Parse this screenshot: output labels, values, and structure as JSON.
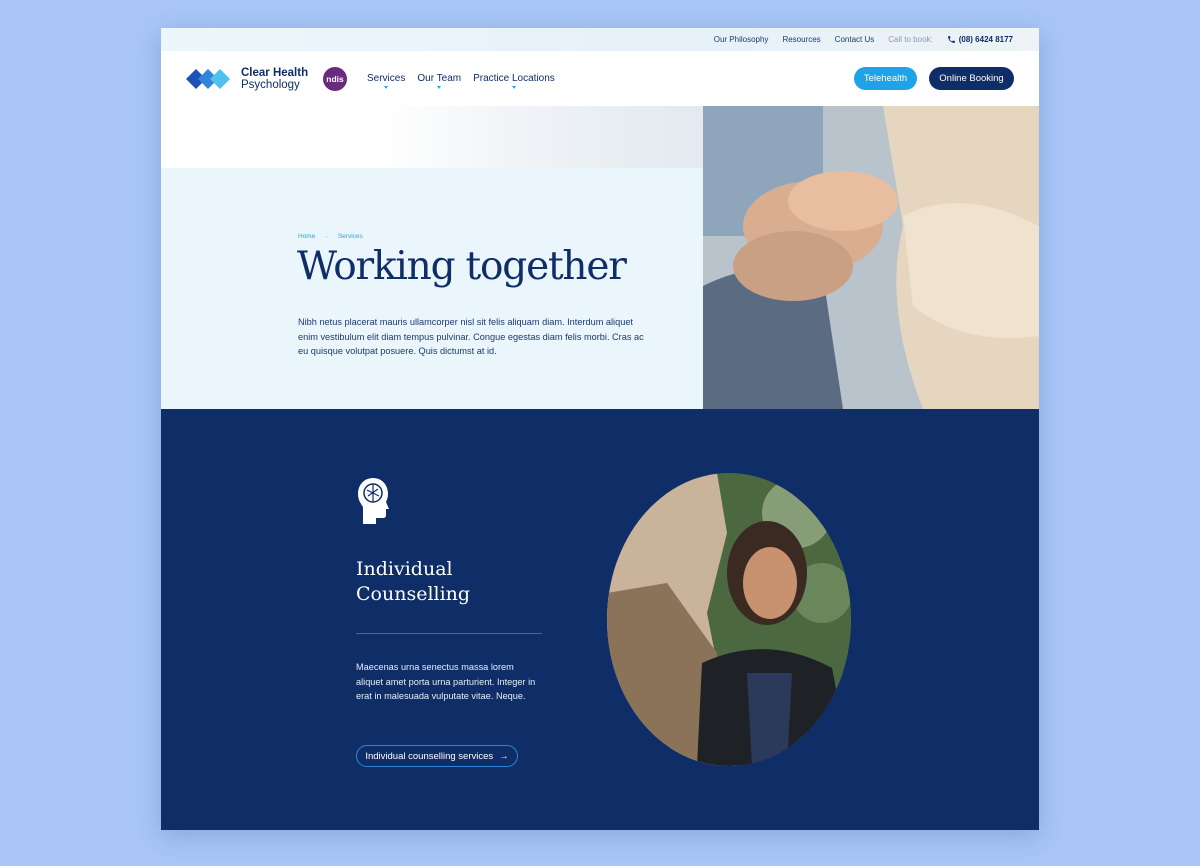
{
  "utility": {
    "links": [
      "Our Philosophy",
      "Resources",
      "Contact Us"
    ],
    "call_label": "Call to book:",
    "phone": "(08) 6424 8177"
  },
  "header": {
    "brand_line1": "Clear Health",
    "brand_line2": "Psychology",
    "ndis_label": "ndis",
    "nav": [
      "Services",
      "Our Team",
      "Practice Locations"
    ],
    "telehealth_label": "Telehealth",
    "booking_label": "Online Booking"
  },
  "hero": {
    "breadcrumb": [
      "Home",
      "Services"
    ],
    "title": "Working together",
    "intro": "Nibh netus placerat mauris ullamcorper nisl sit felis aliquam diam. Interdum aliquet enim vestibulum elit diam tempus pulvinar. Congue egestas diam felis morbi. Cras ac eu quisque volutpat posuere. Quis dictumst at id."
  },
  "service": {
    "title": "Individual Counselling",
    "text": "Maecenas urna senectus massa lorem aliquet amet porta urna parturient. Integer in erat in malesuada vulputate vitae. Neque.",
    "button_label": "Individual counselling services"
  },
  "colors": {
    "navy": "#0f2d66",
    "accent": "#1ea2e8",
    "ndis": "#6a2a7d",
    "hero_bg": "#eaf5fc"
  }
}
